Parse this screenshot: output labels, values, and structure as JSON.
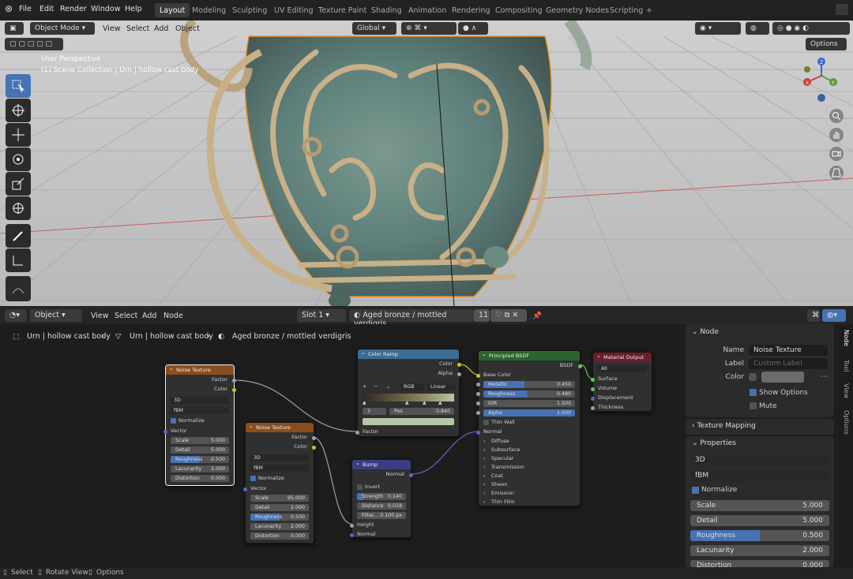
{
  "menu": {
    "items": [
      "File",
      "Edit",
      "Render",
      "Window",
      "Help"
    ]
  },
  "workspaces": {
    "tabs": [
      "Layout",
      "Modeling",
      "Sculpting",
      "UV Editing",
      "Texture Paint",
      "Shading",
      "Animation",
      "Rendering",
      "Compositing",
      "Geometry Nodes",
      "Scripting"
    ],
    "active": "Layout",
    "add": "+"
  },
  "viewport": {
    "mode": "Object Mode",
    "menus": [
      "View",
      "Select",
      "Add",
      "Object"
    ],
    "transform_orientation": "Global",
    "options_label": "Options",
    "overlay_title": "User Perspective",
    "overlay_subtitle": "(1) Scene Collection | Urn | hollow cast body",
    "gizmo": {
      "x": "X",
      "y": "Y",
      "z": "Z"
    },
    "colors": {
      "bg": "#bcbcbc",
      "selection": "#e8902a",
      "bronze": "#c8b088",
      "patina": "#5f8a85"
    }
  },
  "node_editor": {
    "editor_type": "Object",
    "menus": [
      "View",
      "Select",
      "Add",
      "Node"
    ],
    "slot": "Slot 1",
    "material": "Aged bronze / mottled verdigris",
    "users": "11",
    "breadcrumb": [
      "Urn | hollow cast body",
      "Urn | hollow cast body",
      "Aged bronze / mottled verdigris"
    ],
    "noise1": {
      "title": "Noise Texture",
      "out_factor": "Factor",
      "out_color": "Color",
      "dim": "3D",
      "type": "fBM",
      "normalize": "Normalize",
      "vector": "Vector",
      "scale_l": "Scale",
      "scale": "5.000",
      "detail_l": "Detail",
      "detail": "5.000",
      "rough_l": "Roughness",
      "rough": "0.500",
      "lac_l": "Lacunarity",
      "lac": "2.000",
      "dist_l": "Distortion",
      "dist": "0.000"
    },
    "noise2": {
      "title": "Noise Texture",
      "out_factor": "Factor",
      "out_color": "Color",
      "dim": "3D",
      "type": "fBM",
      "normalize": "Normalize",
      "vector": "Vector",
      "scale_l": "Scale",
      "scale": "95.000",
      "detail_l": "Detail",
      "detail": "2.000",
      "rough_l": "Roughness",
      "rough": "0.500",
      "lac_l": "Lacunarity",
      "lac": "2.000",
      "dist_l": "Distortion",
      "dist": "0.000"
    },
    "ramp": {
      "title": "Color Ramp",
      "out_color": "Color",
      "out_alpha": "Alpha",
      "mode": "RGB",
      "interp": "Linear",
      "index": "3",
      "pos_l": "Pos",
      "pos": "0.840",
      "in_factor": "Factor",
      "add": "+",
      "remove": "−"
    },
    "bump": {
      "title": "Bump",
      "out_normal": "Normal",
      "invert": "Invert",
      "strength_l": "Strength",
      "strength": "0.140",
      "distance_l": "Distance",
      "distance": "0.018",
      "filter_l": "Filter...",
      "filter": "0.100 px",
      "height": "Height",
      "normal": "Normal"
    },
    "bsdf": {
      "title": "Principled BSDF",
      "out": "BSDF",
      "base_color": "Base Color",
      "metallic_l": "Metallic",
      "metallic": "0.450",
      "rough_l": "Roughness",
      "rough": "0.480",
      "ior_l": "IOR",
      "ior": "1.500",
      "alpha_l": "Alpha",
      "alpha": "1.000",
      "thin_walled": "Thin Wall",
      "normal": "Normal",
      "panels": [
        "Diffuse",
        "Subsurface",
        "Specular",
        "Transmission",
        "Coat",
        "Sheen",
        "Emission",
        "Thin Film"
      ]
    },
    "output": {
      "title": "Material Output",
      "target": "All",
      "surface": "Surface",
      "volume": "Volume",
      "displacement": "Displacement",
      "thickness": "Thickness"
    },
    "colors": {
      "texture": "#8a4e1e",
      "converter": "#3a6d93",
      "vector": "#3c3c83",
      "shader": "#2b652b",
      "output": "#6e1d2a"
    }
  },
  "sidebar": {
    "node_panel": "Node",
    "name_l": "Name",
    "name": "Noise Texture",
    "label_l": "Label",
    "label_ph": "Custom Label",
    "color_l": "Color",
    "show_options": "Show Options",
    "mute": "Mute",
    "texture_mapping": "Texture Mapping",
    "properties": "Properties",
    "dim": "3D",
    "type": "fBM",
    "normalize": "Normalize",
    "scale_l": "Scale",
    "scale": "5.000",
    "detail_l": "Detail",
    "detail": "5.000",
    "rough_l": "Roughness",
    "rough": "0.500",
    "lac_l": "Lacunarity",
    "lac": "2.000",
    "dist_l": "Distortion",
    "dist": "0.000",
    "tabs": [
      "Node",
      "Tool",
      "View",
      "Options"
    ]
  },
  "status": {
    "select": "Select",
    "rotate": "Rotate View",
    "options": "Options"
  }
}
